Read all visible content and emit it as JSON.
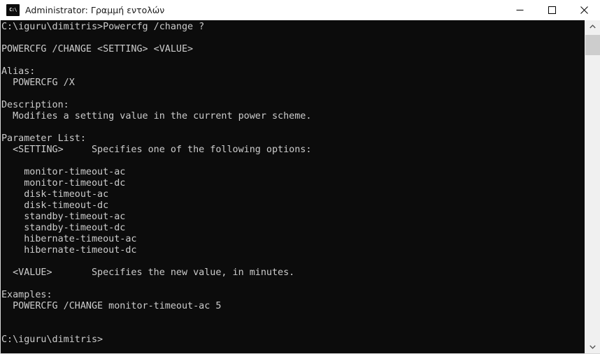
{
  "window": {
    "title": "Administrator: Γραμμή εντολών",
    "icon_name": "cmd-icon",
    "icon_glyph": "C:\\",
    "colors": {
      "titlebar_bg": "#ffffff",
      "console_bg": "#0c0c0c",
      "console_fg": "#cccccc",
      "scrollbar_track": "#f0f0f0",
      "scrollbar_thumb": "#cdcdcd",
      "window_border": "#d8d8d8"
    }
  },
  "titlebar_buttons": {
    "minimize": "Minimize",
    "maximize": "Maximize",
    "close": "Close"
  },
  "scrollbar": {
    "up_label": "Scroll up",
    "down_label": "Scroll down",
    "thumb_label": "Scroll thumb"
  },
  "console": {
    "prompt_path": "C:\\iguru\\dimitris>",
    "command": "Powercfg /change ?",
    "lines": [
      "C:\\iguru\\dimitris>Powercfg /change ?",
      "",
      "POWERCFG /CHANGE <SETTING> <VALUE>",
      "",
      "Alias:",
      "  POWERCFG /X",
      "",
      "Description:",
      "  Modifies a setting value in the current power scheme.",
      "",
      "Parameter List:",
      "  <SETTING>     Specifies one of the following options:",
      "",
      "    monitor-timeout-ac",
      "    monitor-timeout-dc",
      "    disk-timeout-ac",
      "    disk-timeout-dc",
      "    standby-timeout-ac",
      "    standby-timeout-dc",
      "    hibernate-timeout-ac",
      "    hibernate-timeout-dc",
      "",
      "  <VALUE>       Specifies the new value, in minutes.",
      "",
      "Examples:",
      "  POWERCFG /CHANGE monitor-timeout-ac 5",
      "",
      "",
      "C:\\iguru\\dimitris>"
    ]
  }
}
